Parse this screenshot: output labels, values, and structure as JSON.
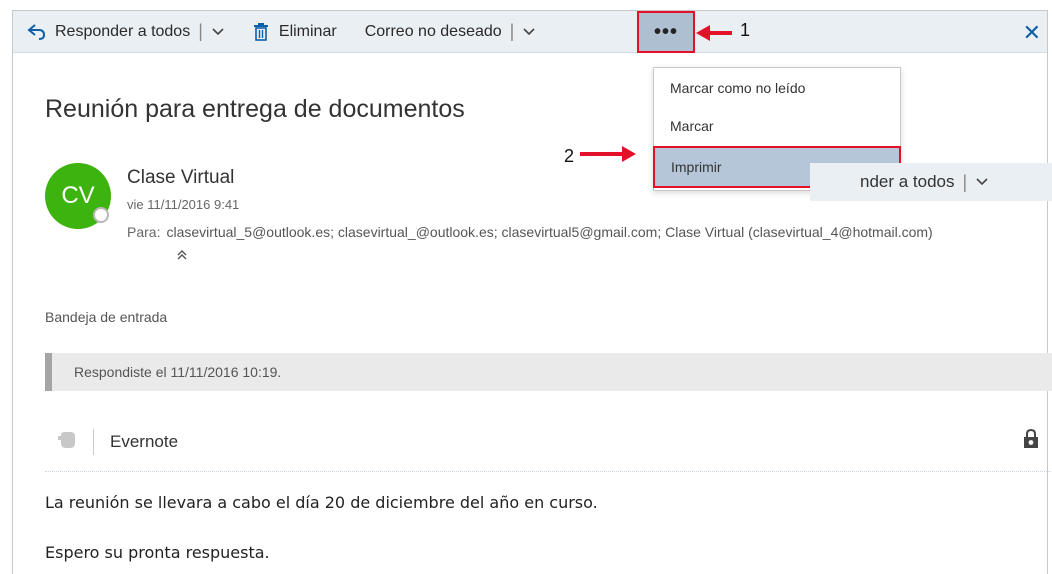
{
  "toolbar": {
    "reply_all_label": "Responder a todos",
    "delete_label": "Eliminar",
    "junk_label": "Correo no deseado",
    "more_label": "•••"
  },
  "menu": {
    "items": [
      "Marcar como no leído",
      "Marcar",
      "Imprimir"
    ],
    "highlighted": "Imprimir"
  },
  "annotations": {
    "one": "1",
    "two": "2"
  },
  "email": {
    "subject": "Reunión para entrega de documentos",
    "avatar_initials": "CV",
    "sender": "Clase Virtual",
    "date": "vie 11/11/2016 9:41",
    "to_label": "Para:",
    "to_value": "clasevirtual_5@outlook.es; clasevirtual_@outlook.es; clasevirtual5@gmail.com; Clase Virtual (clasevirtual_4@hotmail.com)",
    "reply_all_partial": "nder a todos",
    "folder": "Bandeja de entrada",
    "replied_notice": "Respondiste el 11/11/2016 10:19.",
    "addin_label": "Evernote",
    "body_line1": "La reunión se llevara a cabo el día 20 de diciembre del año en curso.",
    "body_line2": "Espero su pronta respuesta."
  },
  "colors": {
    "accent": "#0f5fa8",
    "highlight_border": "#e3102a",
    "avatar": "#3db30f"
  },
  "icons": [
    "reply-all-icon",
    "trash-icon",
    "chevron-down-icon",
    "close-icon",
    "double-chevron-up-icon",
    "evernote-icon",
    "lock-icon"
  ]
}
